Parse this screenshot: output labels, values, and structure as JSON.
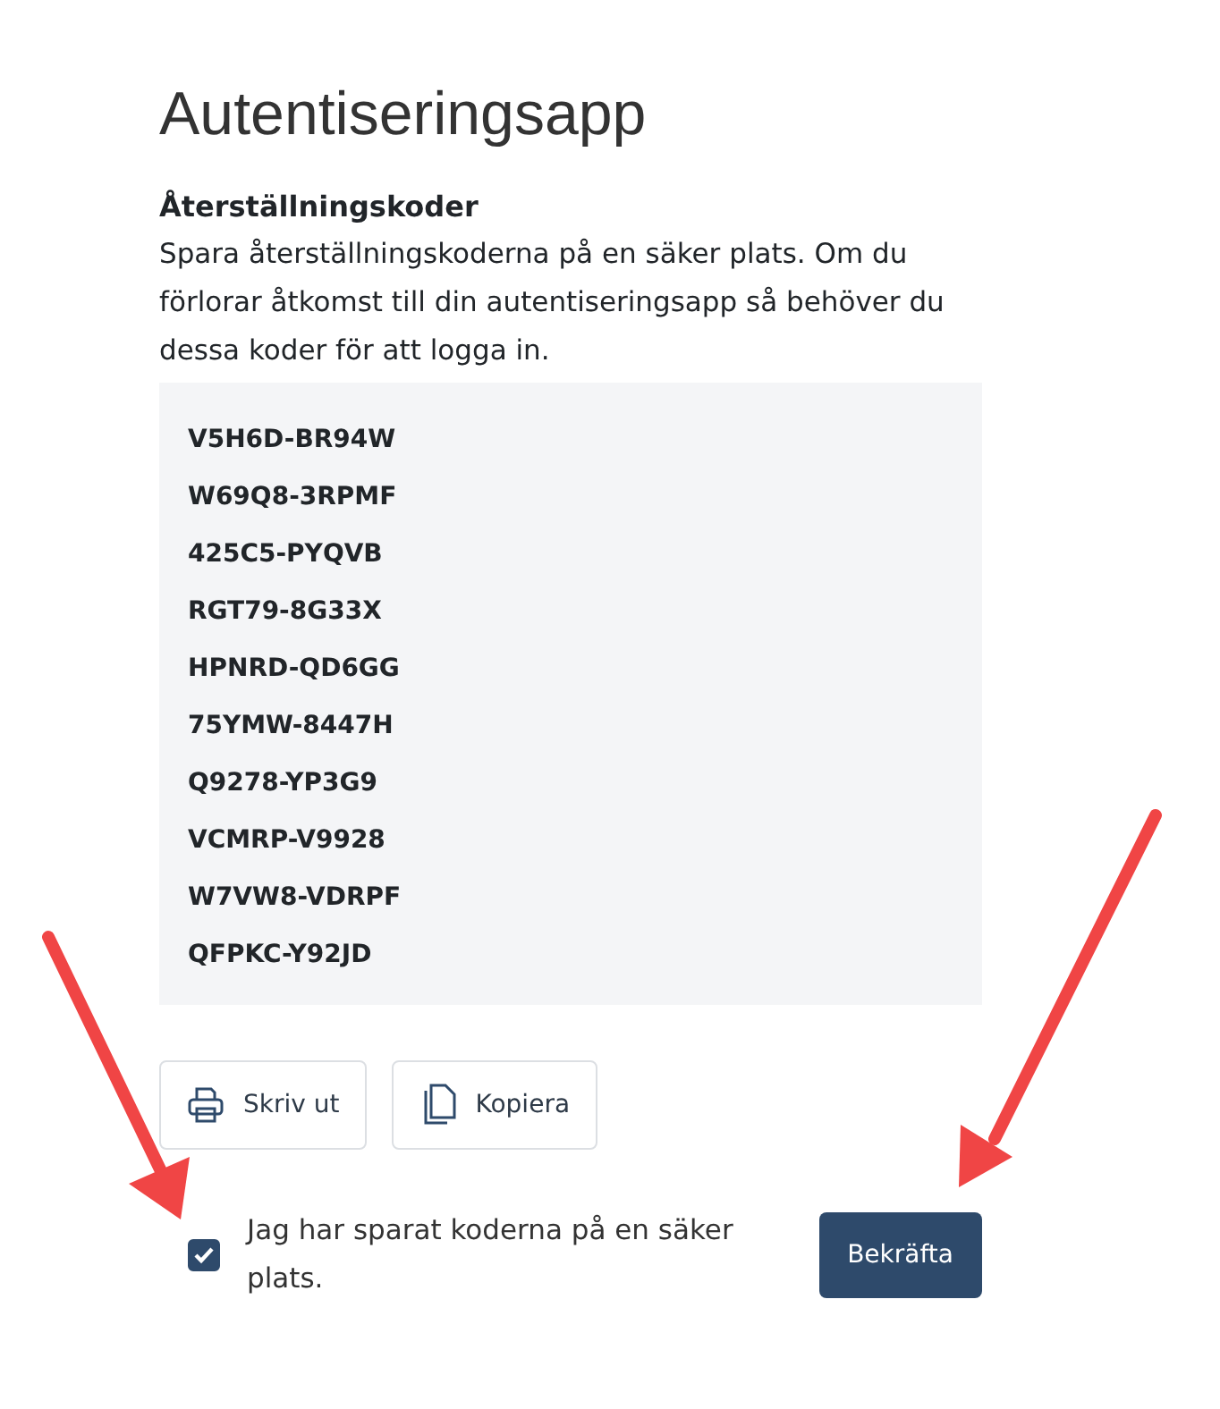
{
  "title": "Autentiseringsapp",
  "section": {
    "heading": "Återställningskoder",
    "description": "Spara återställningskoderna på en säker plats. Om du förlorar åtkomst till din autentiseringsapp så behöver du dessa koder för att logga in."
  },
  "codes": [
    "V5H6D-BR94W",
    "W69Q8-3RPMF",
    "425C5-PYQVB",
    "RGT79-8G33X",
    "HPNRD-QD6GG",
    "75YMW-8447H",
    "Q9278-YP3G9",
    "VCMRP-V9928",
    "W7VW8-VDRPF",
    "QFPKC-Y92JD"
  ],
  "actions": [
    {
      "kind": "print",
      "label": "Skriv ut"
    },
    {
      "kind": "copy",
      "label": "Kopiera"
    }
  ],
  "confirm": {
    "checked": true,
    "label": "Jag har sparat koderna på en säker plats.",
    "button": "Bekräfta"
  }
}
